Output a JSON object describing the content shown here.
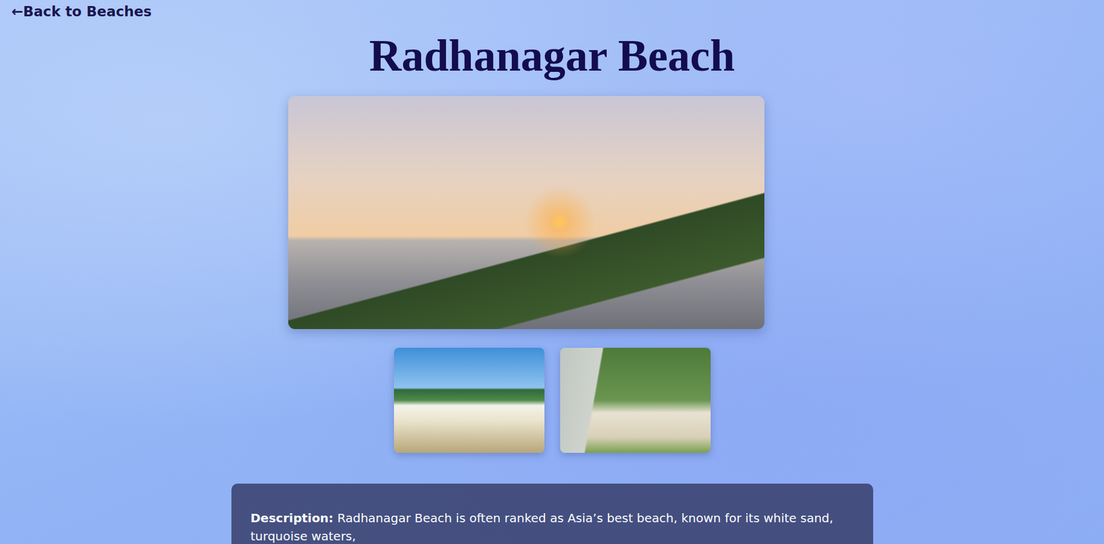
{
  "back_link": {
    "arrow": "←",
    "label": "Back to Beaches"
  },
  "title": "Radhanagar Beach",
  "description": {
    "label": "Description:",
    "text": "Radhanagar Beach is often ranked as Asia’s best beach, known for its white sand, turquoise waters,"
  }
}
